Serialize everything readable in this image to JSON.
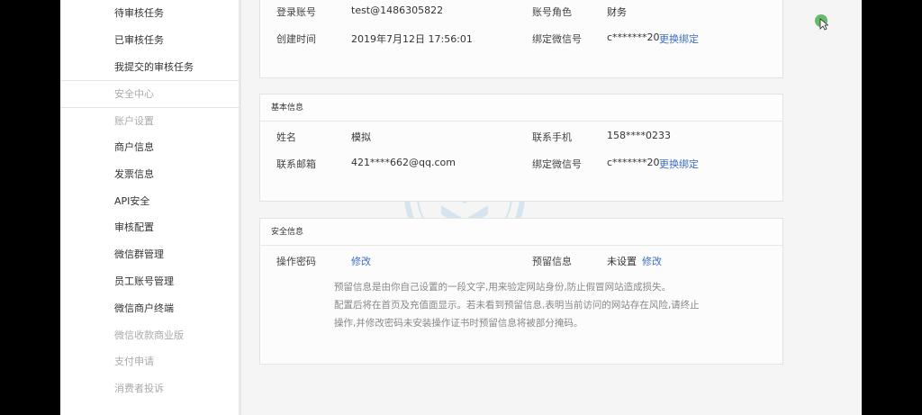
{
  "sidebar": {
    "items": [
      {
        "label": "待审核任务",
        "kind": "link"
      },
      {
        "label": "已审核任务",
        "kind": "link"
      },
      {
        "label": "我提交的审核任务",
        "kind": "link"
      },
      {
        "label": "安全中心",
        "kind": "section"
      },
      {
        "label": "账户设置",
        "kind": "section"
      },
      {
        "label": "商户信息",
        "kind": "link"
      },
      {
        "label": "发票信息",
        "kind": "link"
      },
      {
        "label": "API安全",
        "kind": "link"
      },
      {
        "label": "审核配置",
        "kind": "link"
      },
      {
        "label": "微信群管理",
        "kind": "link"
      },
      {
        "label": "员工账号管理",
        "kind": "link"
      },
      {
        "label": "微信商户终端",
        "kind": "link"
      },
      {
        "label": "微信收款商业版",
        "kind": "muted"
      },
      {
        "label": "支付申请",
        "kind": "muted"
      },
      {
        "label": "消费者投诉",
        "kind": "muted"
      }
    ]
  },
  "account_panel": {
    "login_label": "登录账号",
    "login_value": "test@1486305822",
    "role_label": "账号角色",
    "role_value": "财务",
    "created_label": "创建时间",
    "created_value": "2019年7月12日 17:56:01",
    "wechat_label": "绑定微信号",
    "wechat_value": "c*******20",
    "wechat_action": "更换绑定"
  },
  "basic_panel": {
    "title": "基本信息",
    "name_label": "姓名",
    "name_value": "模拟",
    "phone_label": "联系手机",
    "phone_value": "158****0233",
    "email_label": "联系邮箱",
    "email_value": "421****662@qq.com",
    "wechat_label": "绑定微信号",
    "wechat_value": "c*******20",
    "wechat_action": "更换绑定"
  },
  "security_panel": {
    "title": "安全信息",
    "password_label": "操作密码",
    "password_action": "修改",
    "reserved_label": "预留信息",
    "reserved_value": "未设置",
    "reserved_action": "修改",
    "note_lines": [
      "预留信息是由你自己设置的一段文字,用来验定网站身份,防止假冒网站造成损失。",
      "配置后将在首页及充值面显示。若未看到预留信息,表明当前访问的网站存在风险,请终止",
      "操作,并修改密码未安装操作证书时预留信息将被部分掩码。"
    ]
  },
  "colors": {
    "link": "#3d6fc2",
    "cursor": "#4caf50",
    "watermark": "#3d8fd0"
  }
}
